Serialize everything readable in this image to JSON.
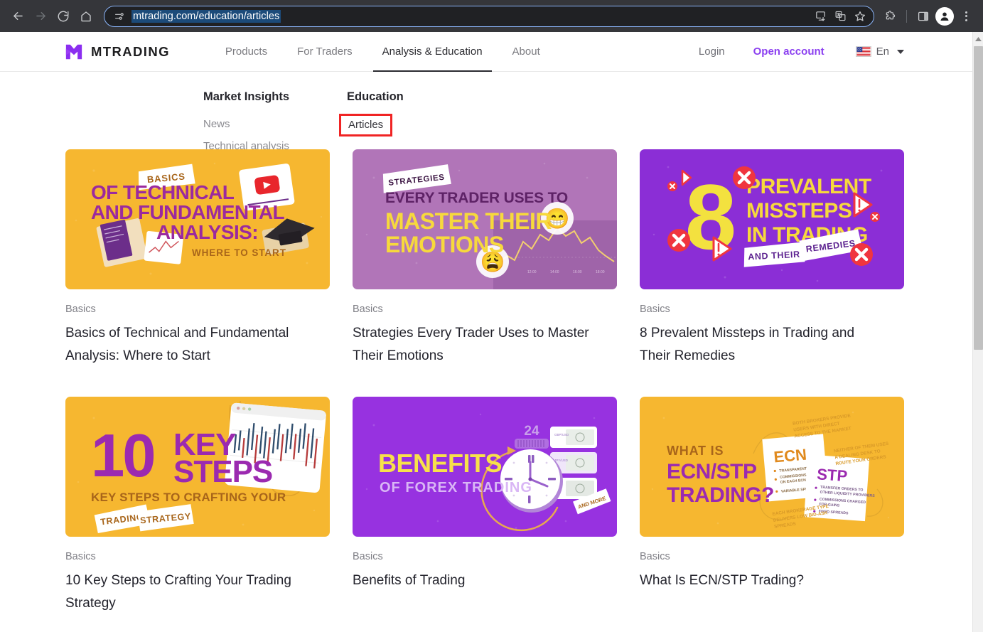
{
  "browser": {
    "back_label": "Back",
    "forward_label": "Forward",
    "reload_label": "Reload",
    "home_label": "Home",
    "url": "mtrading.com/education/articles",
    "site_settings_icon": "tune-icon",
    "install_icon": "install-app-icon",
    "translate_icon": "translate-icon",
    "bookmark_icon": "bookmark-star-icon",
    "extensions_icon": "extensions-puzzle-icon",
    "side_panel_icon": "side-panel-icon",
    "profile_icon": "profile-avatar-icon",
    "menu_icon": "three-dot-menu-icon",
    "url_selected": true,
    "theme_bg": "#35363a",
    "omnibox_bg": "#202124",
    "omnibox_border": "#8ab4f8",
    "selection_bg": "#1c4b7a"
  },
  "site": {
    "brand": "MTRADING",
    "logo_icon": "mtrading-m-logo",
    "accent_color": "#8b3ff0",
    "nav": [
      {
        "label": "Products",
        "active": false
      },
      {
        "label": "For Traders",
        "active": false
      },
      {
        "label": "Analysis & Education",
        "active": true
      },
      {
        "label": "About",
        "active": false
      }
    ],
    "login_label": "Login",
    "open_account_label": "Open account",
    "language": {
      "label": "En",
      "flag_icon": "us-flag-icon",
      "caret_icon": "chevron-down-icon"
    }
  },
  "mega_menu": {
    "columns": [
      {
        "title": "Market Insights",
        "links": [
          {
            "label": "News",
            "highlighted": false
          },
          {
            "label": "Technical analysis",
            "highlighted": false
          }
        ]
      },
      {
        "title": "Education",
        "links": [
          {
            "label": "Articles",
            "highlighted": true
          }
        ]
      }
    ],
    "highlight_color": "#f02424"
  },
  "articles": [
    {
      "category": "Basics",
      "title": "Basics of Technical and Fundamental Analysis: Where to Start",
      "thumb": {
        "style": "yellow",
        "bg": "#f6b730",
        "tag": "BASICS",
        "line1": "OF TECHNICAL",
        "line2": "AND FUNDAMENTAL",
        "line3": "ANALYSIS:",
        "sub": "WHERE TO START",
        "heading_color": "#9b2a9e",
        "sub_color": "#a8651a"
      }
    },
    {
      "category": "Basics",
      "title": "Strategies Every Trader Uses to Master Their Emotions",
      "thumb": {
        "style": "mauve",
        "bg": "#b175b8",
        "tag": "STRATEGIES",
        "line1": "EVERY TRADER USES TO",
        "line2": "MASTER THEIR",
        "line3": "EMOTIONS",
        "heading_color": "#5e2266",
        "accent_color": "#f7d93c",
        "emoji1": "😁",
        "emoji2": "😩"
      }
    },
    {
      "category": "Basics",
      "title": "8 Prevalent Missteps in Trading and Their Remedies",
      "thumb": {
        "style": "purple-8",
        "bg": "#8b2ed6",
        "big_number": "8",
        "line1": "PREVALENT",
        "line2": "MISSTEPS",
        "line3": "IN TRADING",
        "tag1": "AND THEIR",
        "tag2": "REMEDIES",
        "number_color": "#f3e13f",
        "heading_color": "#f7d93c",
        "mark_color": "#f0353f"
      }
    },
    {
      "category": "Basics",
      "title": "10 Key Steps to Crafting Your Trading Strategy",
      "thumb": {
        "style": "yellow-10",
        "bg": "#f6b730",
        "big_number": "10",
        "line1": "KEY",
        "line2": "STEPS",
        "sub": "KEY STEPS TO CRAFTING YOUR",
        "tag1": "TRADING",
        "tag2": "STRATEGY",
        "heading_color": "#9b2ab0",
        "sub_color": "#a8651a"
      }
    },
    {
      "category": "Basics",
      "title": "Benefits of Trading",
      "thumb": {
        "style": "purple-clock",
        "bg": "#9732e0",
        "line1": "BENEFITS",
        "sub": "OF FOREX TRADING",
        "clock_label": "24",
        "tag": "AND MORE",
        "heading_color": "#f7e14a",
        "sub_color": "#d9b6f5"
      }
    },
    {
      "category": "Basics",
      "title": "What Is ECN/STP Trading?",
      "thumb": {
        "style": "yellow-ecn",
        "bg": "#f6b730",
        "eyebrow": "WHAT IS",
        "line1": "ECN/STP",
        "line2": "TRADING?",
        "card1": "ECN",
        "card2": "STP",
        "note_top": "BOTH BROKERS PROVIDE USERS WITH DIRECT ACCESS TO THE MARKET",
        "note_right": "NEITHER OF THEM USES A DEALING DESK TO ROUTE YOUR ORDERS",
        "note_bottom": "EACH BROKERAGE TYPE DELIVERS LOW BID-ASK SPREADS",
        "heading_color": "#9b2ab0",
        "eyebrow_color": "#a8651a",
        "ecn_color": "#e08a1e",
        "stp_color": "#9b2ab0"
      }
    }
  ],
  "scrollbar": {
    "thumb_color": "#c1c1c1",
    "track_color": "#f1f1f1",
    "up_arrow_icon": "scroll-up-arrow-icon"
  }
}
